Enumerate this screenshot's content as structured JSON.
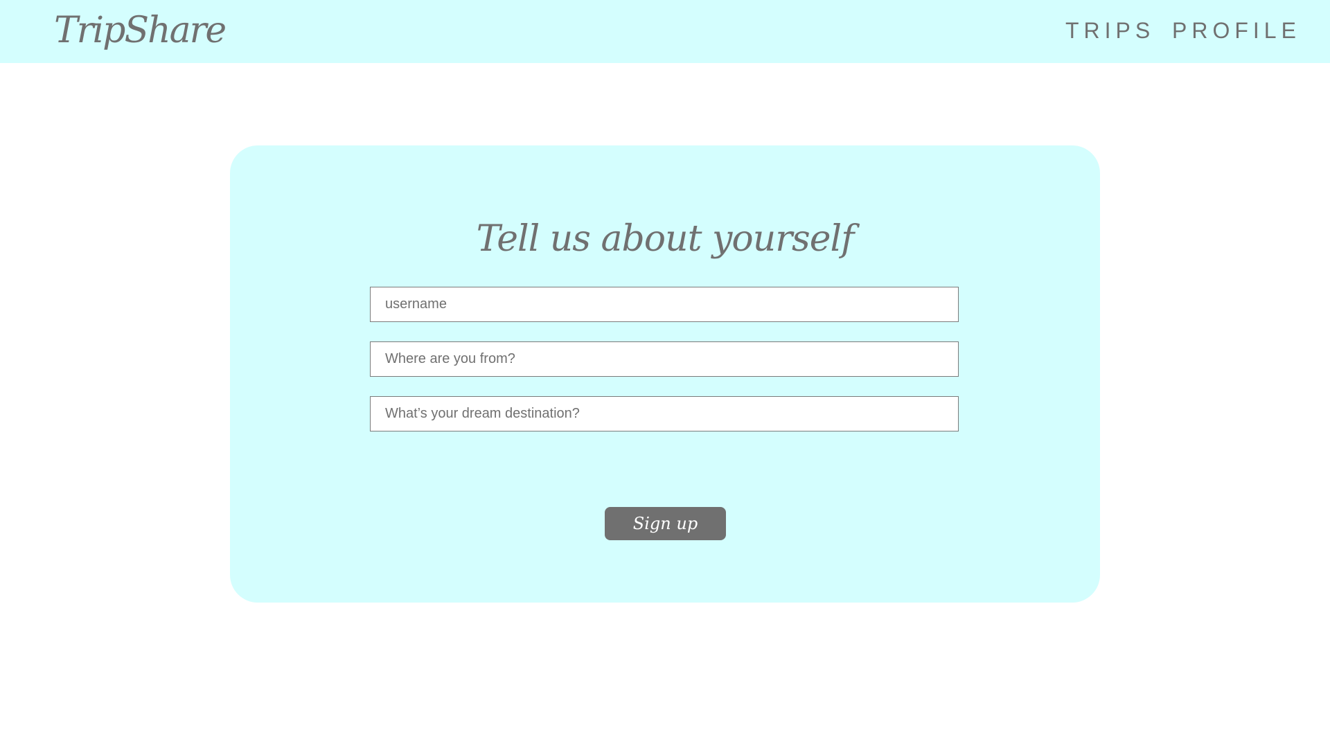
{
  "header": {
    "logo": "TripShare",
    "nav": {
      "trips": "TRIPS",
      "profile": "PROFILE"
    },
    "background_color": "#d4fefe"
  },
  "signup_form": {
    "title": "Tell us about yourself",
    "fields": [
      {
        "placeholder": "username",
        "value": ""
      },
      {
        "placeholder": "Where are you from?",
        "value": ""
      },
      {
        "placeholder": "What’s your dream destination?",
        "value": ""
      }
    ],
    "submit_label": "Sign up",
    "card_color": "#d4fefe",
    "button_color": "#707070",
    "text_color": "#707070"
  }
}
